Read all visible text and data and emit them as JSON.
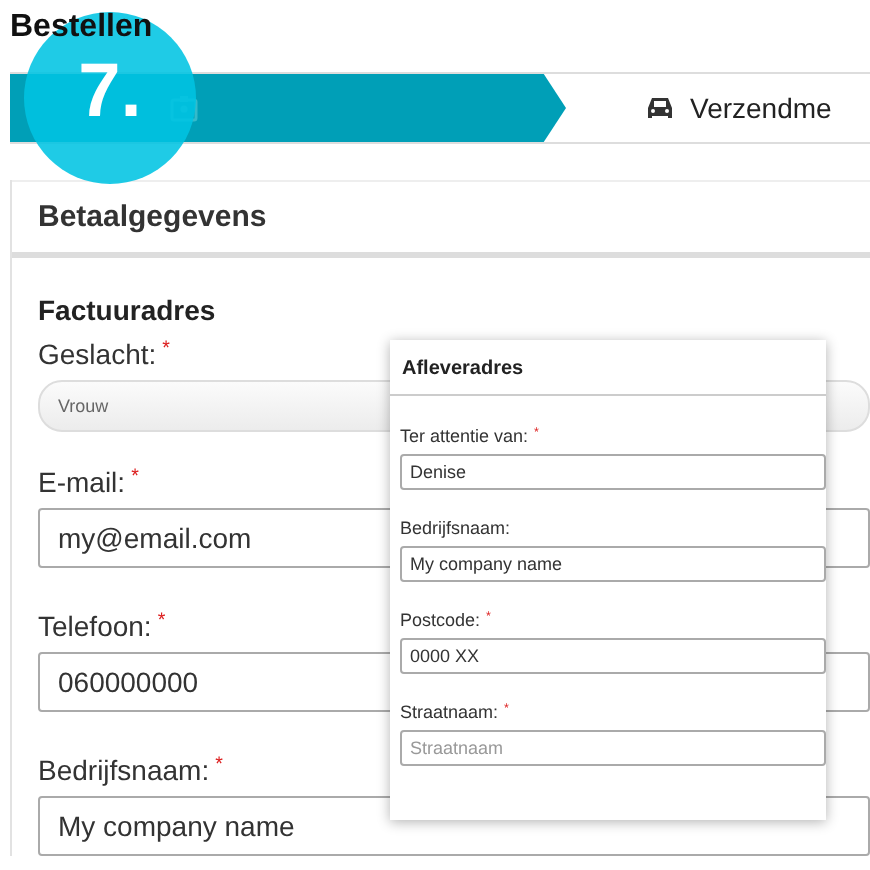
{
  "page_title": "Bestellen",
  "step_badge": "7.",
  "steps": [
    {
      "selected": true
    },
    {
      "label": "Verzendme",
      "selected": false
    }
  ],
  "panel": {
    "title": "Betaalgegevens",
    "section": "Factuuradres",
    "fields": [
      {
        "kind": "select",
        "label": "Geslacht:",
        "required_mark": "*",
        "value": "Vrouw"
      },
      {
        "kind": "input",
        "label": "E-mail:",
        "required_mark": "*",
        "value": "my@email.com"
      },
      {
        "kind": "input",
        "label": "Telefoon:",
        "required_mark": "*",
        "value": "060000000"
      },
      {
        "kind": "input",
        "label": "Bedrijfsnaam:",
        "required_mark": "*",
        "value": "My company name"
      }
    ]
  },
  "popup": {
    "title": "Afleveradres",
    "fields": [
      {
        "kind": "input",
        "label": "Ter attentie van:",
        "required_mark": "*",
        "value": "Denise"
      },
      {
        "kind": "input",
        "label": "Bedrijfsnaam:",
        "value": "My company name"
      },
      {
        "kind": "input",
        "label": "Postcode:",
        "required_mark": "*",
        "value": "0000 XX"
      },
      {
        "kind": "input",
        "label": "Straatnaam:",
        "required_mark": "*",
        "placeholder": "Straatnaam"
      }
    ]
  }
}
